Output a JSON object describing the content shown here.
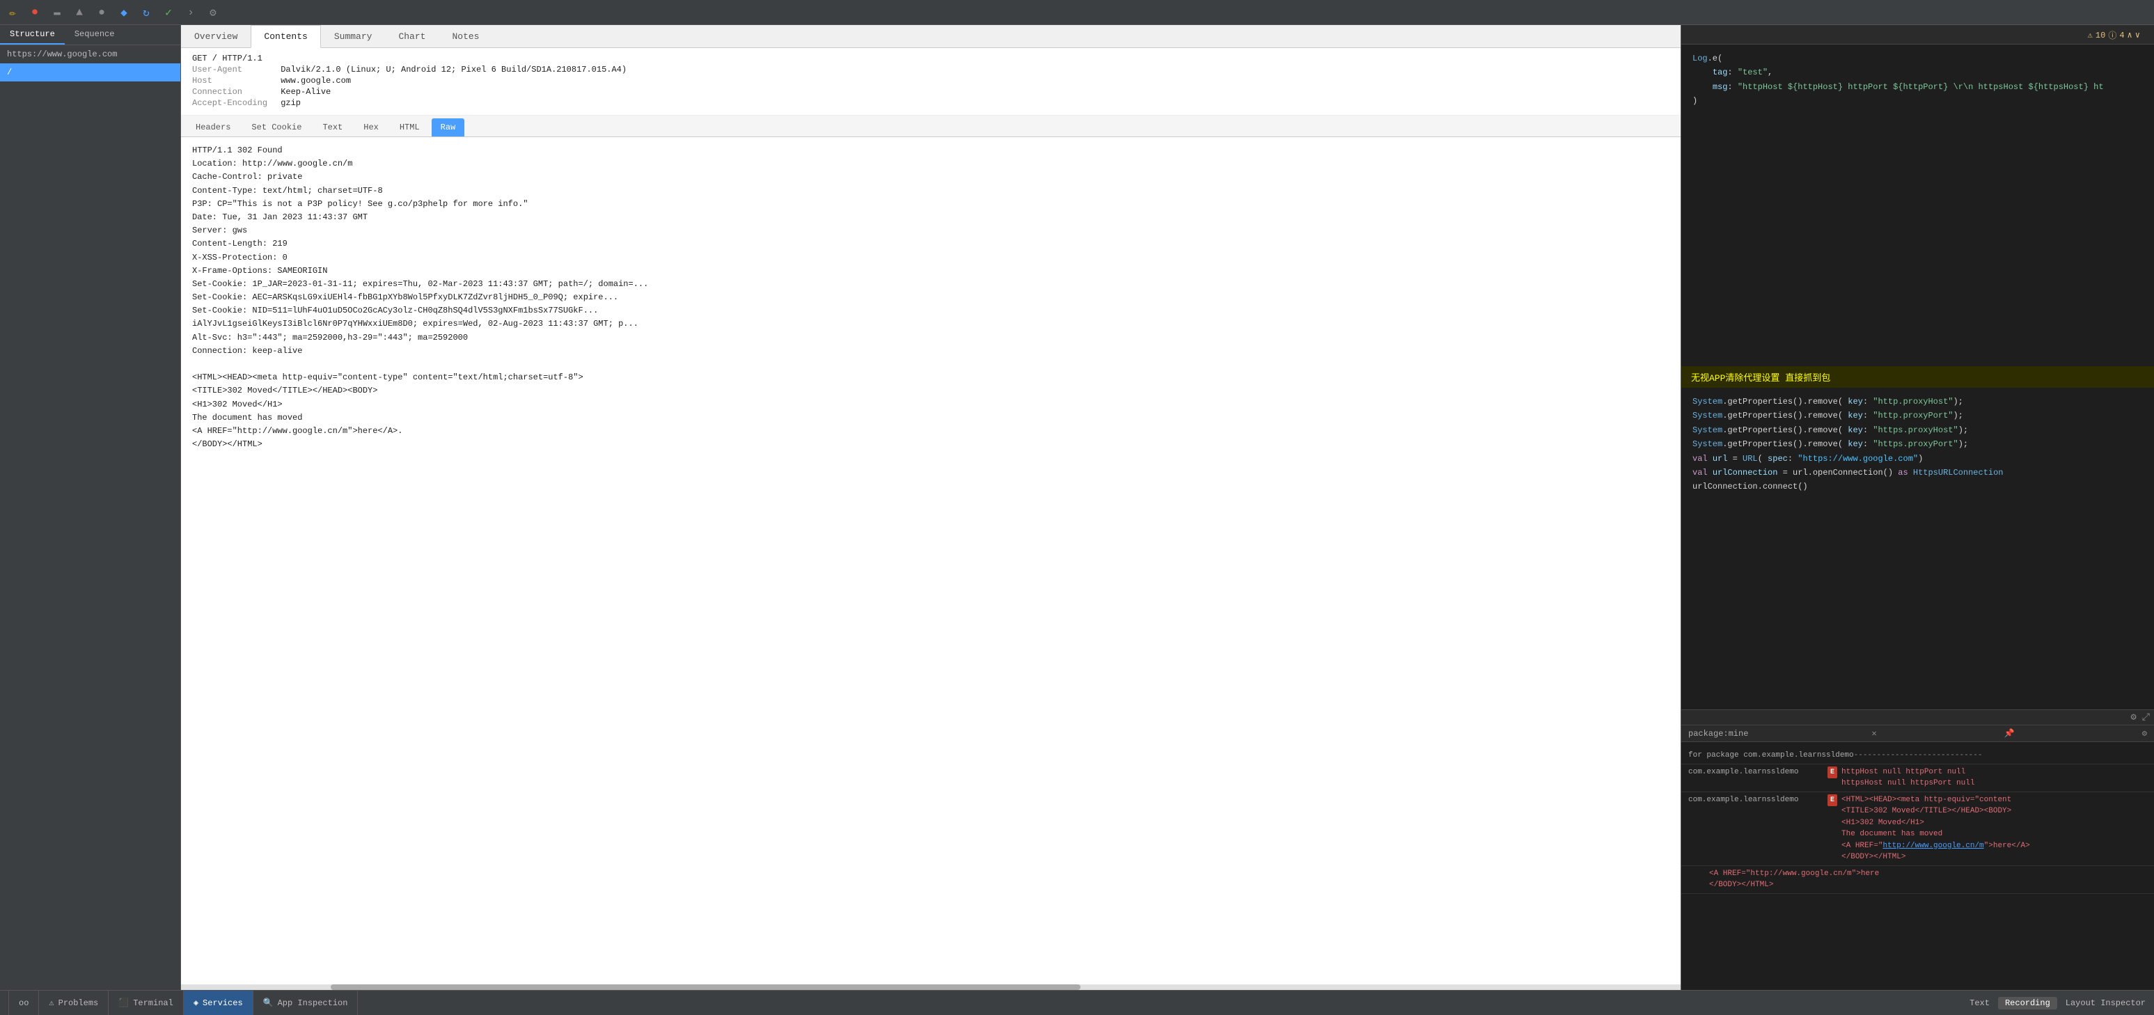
{
  "toolbar": {
    "icons": [
      {
        "name": "pencil-icon",
        "symbol": "✏️"
      },
      {
        "name": "record-icon",
        "symbol": "⏺",
        "color": "red"
      },
      {
        "name": "bug-icon",
        "symbol": "🐛"
      },
      {
        "name": "cloud-icon",
        "symbol": "☁"
      },
      {
        "name": "circle-icon",
        "symbol": "●"
      },
      {
        "name": "bookmark-icon",
        "symbol": "🔖",
        "color": "blue"
      },
      {
        "name": "refresh-icon",
        "symbol": "↻",
        "color": "blue"
      },
      {
        "name": "check-icon",
        "symbol": "✓",
        "color": "green"
      },
      {
        "name": "arrow-icon",
        "symbol": "›"
      },
      {
        "name": "settings-icon",
        "symbol": "⚙"
      }
    ]
  },
  "left_panel": {
    "tabs": [
      {
        "label": "Structure",
        "active": false
      },
      {
        "label": "Sequence",
        "active": false
      }
    ],
    "url1": "https://www.google.com",
    "url2": "/"
  },
  "center_panel": {
    "tabs": [
      {
        "label": "Overview",
        "active": false
      },
      {
        "label": "Contents",
        "active": true
      },
      {
        "label": "Summary",
        "active": false
      },
      {
        "label": "Chart",
        "active": false
      },
      {
        "label": "Notes",
        "active": false
      }
    ],
    "request": {
      "method_path": "GET / HTTP/1.1",
      "user_agent_label": "User-Agent",
      "user_agent_value": "Dalvik/2.1.0 (Linux; U; Android 12; Pixel 6 Build/SD1A.210817.015.A4)",
      "host_label": "Host",
      "host_value": "www.google.com",
      "connection_label": "Connection",
      "connection_value": "Keep-Alive",
      "accept_encoding_label": "Accept-Encoding",
      "accept_encoding_value": "gzip"
    },
    "sub_tabs": [
      {
        "label": "Headers",
        "active": false
      },
      {
        "label": "Raw",
        "active": false
      }
    ],
    "response_tabs": [
      {
        "label": "Headers",
        "active": false
      },
      {
        "label": "Set Cookie",
        "active": false
      },
      {
        "label": "Text",
        "active": false
      },
      {
        "label": "Hex",
        "active": false
      },
      {
        "label": "HTML",
        "active": false
      },
      {
        "label": "Raw",
        "active": true
      }
    ],
    "response_body": "HTTP/1.1 302 Found\nLocation: http://www.google.cn/m\nCache-Control: private\nContent-Type: text/html; charset=UTF-8\nP3P: CP=\"This is not a P3P policy! See g.co/p3phelp for more info.\"\nDate: Tue, 31 Jan 2023 11:43:37 GMT\nServer: gws\nContent-Length: 219\nX-XSS-Protection: 0\nX-Frame-Options: SAMEORIGIN\nSet-Cookie: 1P_JAR=2023-01-31-11; expires=Thu, 02-Mar-2023 11:43:37 GMT; path=/; domain=...\nSet-Cookie: AEC=ARSKqsLG9xiUEHl4-fbBG1pXYb8Wol5PfxyDLK7ZdZvr8ljHDH5_0_P09Q; expire...\nSet-Cookie: NID=511=lUhF4uO1uD5OCo2GcACy3olz-CH0qZ8hSQ4dlV5S3gNXFm1bsSx77SUGkF...\niAlYJvL1gseiGlKeysI3iBlcl6Nr0P7qYHWxxiUEm8D0; expires=Wed, 02-Aug-2023 11:43:37 GMT; p...\nAlt-Svc: h3=\":443\"; ma=2592000,h3-29=\":443\"; ma=2592000\nConnection: keep-alive\n\n<HTML><HEAD><meta http-equiv=\"content-type\" content=\"text/html;charset=utf-8\">\n<TITLE>302 Moved</TITLE></HEAD><BODY>\n<H1>302 Moved</H1>\nThe document has moved\n<A HREF=\"http://www.google.cn/m\">here</A>.\n</BODY></HTML>"
  },
  "right_panel": {
    "warning": "⚠ 10  ⓘ 4  ∧  ∨",
    "code_lines": [
      {
        "text": "Log.e(",
        "type": "plain"
      },
      {
        "text": "    tag: \"test\",",
        "type": "tag"
      },
      {
        "text": "    msg: \"httpHost ${httpHost} httpPort ${httpPort} \\r\\n httpsHost ${httpsHost} ht",
        "type": "msg"
      },
      {
        "text": ")",
        "type": "plain"
      },
      {
        "text": "",
        "type": "plain"
      },
      {
        "text": "无视APP清除代理设置 直接抓到包",
        "type": "chinese-comment"
      },
      {
        "text": "",
        "type": "plain"
      },
      {
        "text": "System.getProperties().remove( key: \"http.proxyHost\");",
        "type": "system"
      },
      {
        "text": "System.getProperties().remove( key: \"http.proxyPort\");",
        "type": "system"
      },
      {
        "text": "System.getProperties().remove( key: \"https.proxyHost\");",
        "type": "system"
      },
      {
        "text": "System.getProperties().remove( key: \"https.proxyPort\");",
        "type": "system"
      },
      {
        "text": "",
        "type": "plain"
      },
      {
        "text": "val url = URL( spec: \"https://www.google.com\")",
        "type": "val-url"
      },
      {
        "text": "val urlConnection = url.openConnection() as HttpsURLConnection",
        "type": "val-conn"
      },
      {
        "text": "urlConnection.connect()",
        "type": "plain"
      }
    ],
    "package": "package:mine",
    "log_entries": [
      {
        "pkg": "for package com.example.learnssldemo",
        "dashes": "----------------------------"
      },
      {
        "pkg1": "com.example.learnssldemo",
        "badge": "E",
        "text": "httpHost null httpPort null\nhttpsHost null httpsPort null"
      },
      {
        "pkg2": "com.example.learnssldemo",
        "badge": "E",
        "text_html": "<HTML><HEAD><meta http-equiv=\"content\n<TITLE>302 Moved</TITLE></HEAD><BODY>\n<H1>302 Moved</H1>\nThe document has moved\n",
        "link": "http://www.google.cn/m",
        "link_suffix": ">here</A>\n</BODY></HTML>"
      }
    ],
    "response_preview": {
      "link_href": "http://www.google.cn/m",
      "link_text": "here",
      "body_close": "</BODY></HTML>"
    }
  },
  "status_bar": {
    "items": [
      {
        "label": "oo",
        "active": false
      },
      {
        "label": "Problems",
        "icon": "warning-icon"
      },
      {
        "label": "Terminal",
        "icon": "terminal-icon"
      },
      {
        "label": "Services",
        "icon": "services-icon"
      },
      {
        "label": "App Inspection",
        "icon": "inspection-icon"
      }
    ],
    "recording_label": "Recording",
    "layout_inspector_label": "Layout Inspector",
    "text_label": "Text"
  }
}
